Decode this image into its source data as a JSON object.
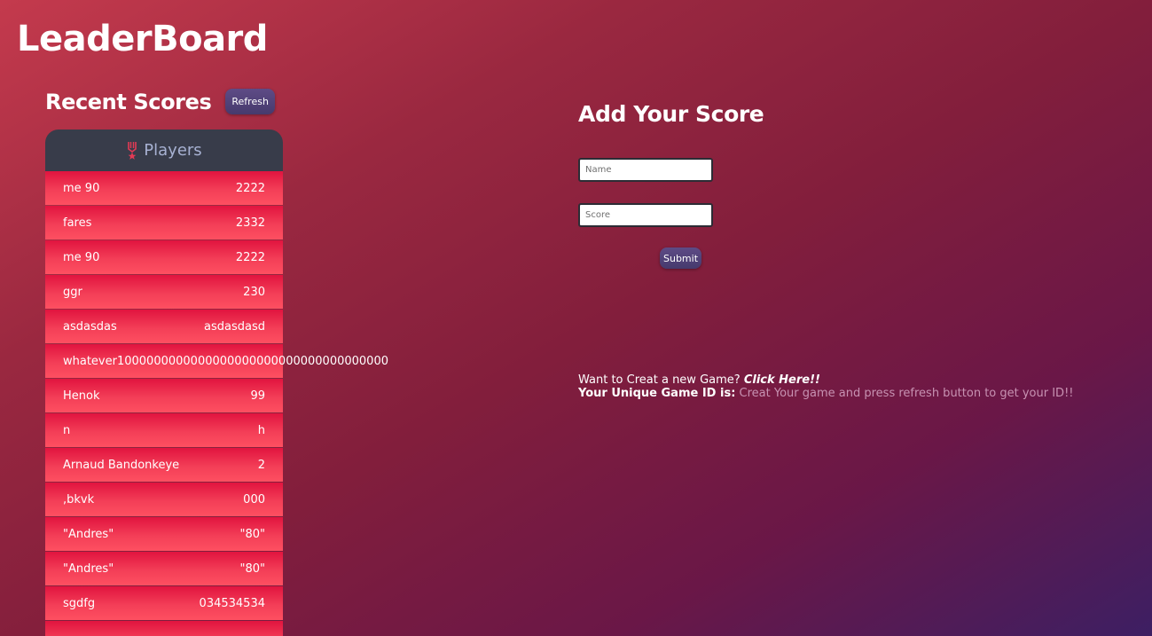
{
  "page": {
    "title": "LeaderBoard"
  },
  "recent_scores": {
    "heading": "Recent Scores",
    "refresh_label": "Refresh",
    "table_header": "Players",
    "trophy_icon": "medal-icon",
    "rows": [
      {
        "name": "me 90",
        "score": "2222"
      },
      {
        "name": "fares",
        "score": "2332"
      },
      {
        "name": "me 90",
        "score": "2222"
      },
      {
        "name": "ggr",
        "score": "230"
      },
      {
        "name": "asdasdas",
        "score": "asdasdasd"
      },
      {
        "name": "whatever1000000000000000000000000000000000000",
        "score": ""
      },
      {
        "name": "Henok",
        "score": "99"
      },
      {
        "name": "n",
        "score": "h"
      },
      {
        "name": "Arnaud Bandonkeye",
        "score": "2"
      },
      {
        "name": ",bkvk",
        "score": "000"
      },
      {
        "name": "\"Andres\"",
        "score": "\"80\""
      },
      {
        "name": "\"Andres\"",
        "score": "\"80\""
      },
      {
        "name": "sgdfg",
        "score": "034534534"
      },
      {
        "name": "",
        "score": ""
      }
    ]
  },
  "add_score": {
    "heading": "Add Your Score",
    "name_placeholder": "Name",
    "score_placeholder": "Score",
    "submit_label": "Submit"
  },
  "footer": {
    "new_game_text": "Want to Creat a new Game?",
    "new_game_link": "Click Here!!",
    "game_id_label": "Your Unique Game ID is:",
    "game_id_value": "Creat Your game and press refresh button to get your ID!!"
  },
  "colors": {
    "row_gradient_top": "#e1143f",
    "row_gradient_bottom": "#fe4f61",
    "table_header_bg": "#383c4a",
    "table_header_text": "#a7b1d2",
    "button_bg": "#5e4b86",
    "game_id_value": "#c792b2"
  }
}
